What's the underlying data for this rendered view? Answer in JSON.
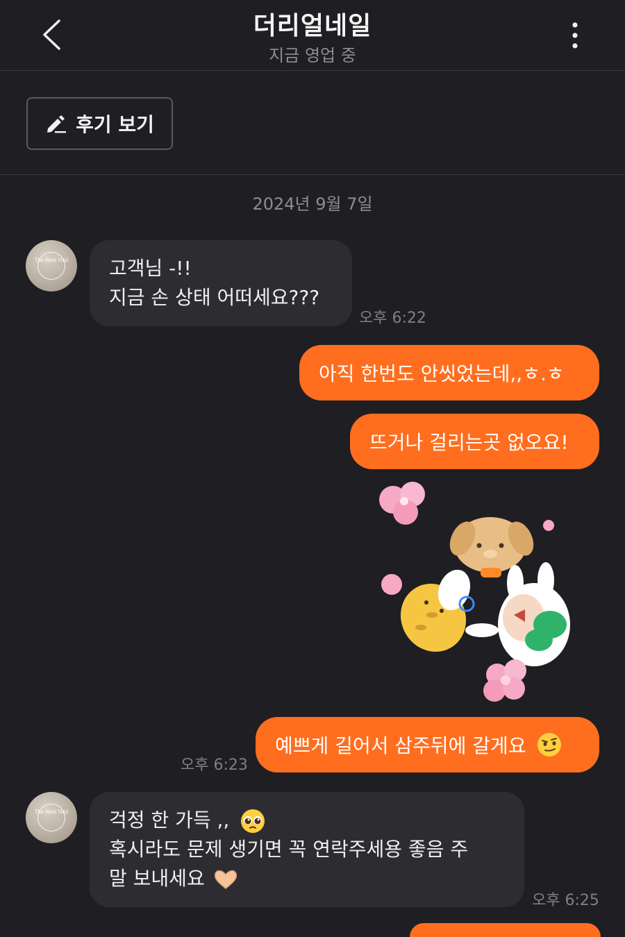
{
  "header": {
    "title": "더리얼네일",
    "subtitle": "지금 영업 중",
    "back_icon": "chevron-left-icon",
    "more_icon": "vertical-dots-icon"
  },
  "review": {
    "label": "후기 보기",
    "icon": "pencil-icon"
  },
  "chat": {
    "date": "2024년 9월 7일",
    "avatar_logo": "The Real Nail",
    "messages": [
      {
        "sender": "shop",
        "text": "고객님 -!!\n지금 손 상태 어떠세요???",
        "time": "오후 6:22"
      },
      {
        "sender": "me",
        "text": "아직 한번도 안씻었는데,,ㅎ.ㅎ"
      },
      {
        "sender": "me",
        "text": "뜨거나 걸리는곳 없오요!"
      },
      {
        "sender": "me",
        "type": "sticker",
        "sticker": "cute-animals-holding-hands-sticker"
      },
      {
        "sender": "me",
        "text": "예쁘게 길어서 삼주뒤에 갈게요",
        "emoji": "smirk-face-emoji",
        "time": "오후 6:23"
      },
      {
        "sender": "shop",
        "text": "걱정 한 가득 ,,",
        "text2": "혹시라도 문제 생기면 꼭 연락주세용 좋음 주\n말 보내세요",
        "emoji1": "pleading-face-emoji",
        "emoji2": "heart-hands-emoji",
        "time": "오후 6:25"
      }
    ]
  },
  "colors": {
    "background": "#1f1e22",
    "outgoing_bubble": "#ff6e1f",
    "incoming_bubble": "#2d2d31"
  }
}
